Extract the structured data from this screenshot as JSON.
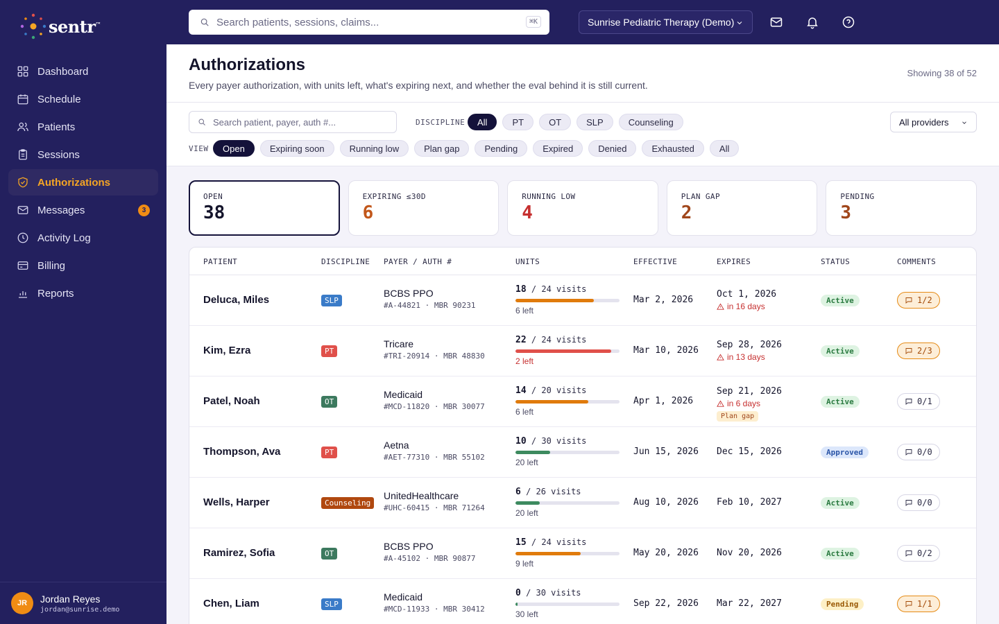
{
  "brand": {
    "name": "sentr",
    "tm": "™"
  },
  "nav": [
    {
      "label": "Dashboard",
      "icon": "grid-icon"
    },
    {
      "label": "Schedule",
      "icon": "calendar-icon"
    },
    {
      "label": "Patients",
      "icon": "users-icon"
    },
    {
      "label": "Sessions",
      "icon": "clipboard-icon"
    },
    {
      "label": "Authorizations",
      "icon": "shield-check-icon",
      "active": true
    },
    {
      "label": "Messages",
      "icon": "mail-icon",
      "badge": "3"
    },
    {
      "label": "Activity Log",
      "icon": "clock-icon"
    },
    {
      "label": "Billing",
      "icon": "credit-card-icon"
    },
    {
      "label": "Reports",
      "icon": "bar-chart-icon"
    }
  ],
  "user": {
    "initials": "JR",
    "name": "Jordan Reyes",
    "email": "jordan@sunrise.demo"
  },
  "topbar": {
    "search_placeholder": "Search patients, sessions, claims...",
    "shortcut": "⌘K",
    "org": "Sunrise Pediatric Therapy (Demo)"
  },
  "page": {
    "title": "Authorizations",
    "subtitle": "Every payer authorization, with units left, what's expiring next, and whether the eval behind it is still current.",
    "showing": "Showing 38 of 52"
  },
  "filters": {
    "search_placeholder": "Search patient, payer, auth #...",
    "discipline_label": "DISCIPLINE",
    "disciplines": [
      "All",
      "PT",
      "OT",
      "SLP",
      "Counseling"
    ],
    "discipline_selected": 0,
    "view_label": "VIEW",
    "views": [
      "Open",
      "Expiring soon",
      "Running low",
      "Plan gap",
      "Pending",
      "Expired",
      "Denied",
      "Exhausted",
      "All"
    ],
    "view_selected": 0,
    "provider": "All providers"
  },
  "stats": [
    {
      "label": "OPEN",
      "value": "38",
      "color": "#14142b",
      "selected": true
    },
    {
      "label": "EXPIRING ≤30D",
      "value": "6",
      "color": "#c2571a"
    },
    {
      "label": "RUNNING LOW",
      "value": "4",
      "color": "#c62f2f"
    },
    {
      "label": "PLAN GAP",
      "value": "2",
      "color": "#a0461b"
    },
    {
      "label": "PENDING",
      "value": "3",
      "color": "#a0461b"
    }
  ],
  "table": {
    "headers": [
      "PATIENT",
      "DISCIPLINE",
      "PAYER / AUTH #",
      "UNITS",
      "EFFECTIVE",
      "EXPIRES",
      "STATUS",
      "COMMENTS"
    ],
    "rows": [
      {
        "patient": "Deluca, Miles",
        "discipline": "SLP",
        "disc_color": "#3a7bc8",
        "payer": "BCBS PPO",
        "auth": "#A-44821 · MBR 90231",
        "used": "18",
        "total": "/ 24 visits",
        "fill": 0.75,
        "fill_color": "#e07b0c",
        "left": "6 left",
        "left_warn": false,
        "effective": "Mar 2, 2026",
        "expires": "Oct 1, 2026",
        "exp_warn": "in 16 days",
        "plan_gap": "",
        "status": "Active",
        "status_kind": "active",
        "comments": "1/2",
        "comments_hot": true
      },
      {
        "patient": "Kim, Ezra",
        "discipline": "PT",
        "disc_color": "#e0504a",
        "payer": "Tricare",
        "auth": "#TRI-20914 · MBR 48830",
        "used": "22",
        "total": "/ 24 visits",
        "fill": 0.917,
        "fill_color": "#e0504a",
        "left": "2 left",
        "left_warn": true,
        "effective": "Mar 10, 2026",
        "expires": "Sep 28, 2026",
        "exp_warn": "in 13 days",
        "plan_gap": "",
        "status": "Active",
        "status_kind": "active",
        "comments": "2/3",
        "comments_hot": true
      },
      {
        "patient": "Patel, Noah",
        "discipline": "OT",
        "disc_color": "#3d7a5f",
        "payer": "Medicaid",
        "auth": "#MCD-11820 · MBR 30077",
        "used": "14",
        "total": "/ 20 visits",
        "fill": 0.7,
        "fill_color": "#e07b0c",
        "left": "6 left",
        "left_warn": false,
        "effective": "Apr 1, 2026",
        "expires": "Sep 21, 2026",
        "exp_warn": "in 6 days",
        "plan_gap": "Plan gap",
        "status": "Active",
        "status_kind": "active",
        "comments": "0/1",
        "comments_hot": false
      },
      {
        "patient": "Thompson, Ava",
        "discipline": "PT",
        "disc_color": "#e0504a",
        "payer": "Aetna",
        "auth": "#AET-77310 · MBR 55102",
        "used": "10",
        "total": "/ 30 visits",
        "fill": 0.333,
        "fill_color": "#3d8a5f",
        "left": "20 left",
        "left_warn": false,
        "effective": "Jun 15, 2026",
        "expires": "Dec 15, 2026",
        "exp_warn": "",
        "plan_gap": "",
        "status": "Approved",
        "status_kind": "approved",
        "comments": "0/0",
        "comments_hot": false
      },
      {
        "patient": "Wells, Harper",
        "discipline": "Counseling",
        "disc_color": "#b0480f",
        "payer": "UnitedHealthcare",
        "auth": "#UHC-60415 · MBR 71264",
        "used": "6",
        "total": "/ 26 visits",
        "fill": 0.231,
        "fill_color": "#3d8a5f",
        "left": "20 left",
        "left_warn": false,
        "effective": "Aug 10, 2026",
        "expires": "Feb 10, 2027",
        "exp_warn": "",
        "plan_gap": "",
        "status": "Active",
        "status_kind": "active",
        "comments": "0/0",
        "comments_hot": false
      },
      {
        "patient": "Ramirez, Sofia",
        "discipline": "OT",
        "disc_color": "#3d7a5f",
        "payer": "BCBS PPO",
        "auth": "#A-45102 · MBR 90877",
        "used": "15",
        "total": "/ 24 visits",
        "fill": 0.625,
        "fill_color": "#e07b0c",
        "left": "9 left",
        "left_warn": false,
        "effective": "May 20, 2026",
        "expires": "Nov 20, 2026",
        "exp_warn": "",
        "plan_gap": "",
        "status": "Active",
        "status_kind": "active",
        "comments": "0/2",
        "comments_hot": false
      },
      {
        "patient": "Chen, Liam",
        "discipline": "SLP",
        "disc_color": "#3a7bc8",
        "payer": "Medicaid",
        "auth": "#MCD-11933 · MBR 30412",
        "used": "0",
        "total": "/ 30 visits",
        "fill": 0.02,
        "fill_color": "#3d8a5f",
        "left": "30 left",
        "left_warn": false,
        "effective": "Sep 22, 2026",
        "expires": "Mar 22, 2027",
        "exp_warn": "",
        "plan_gap": "",
        "status": "Pending",
        "status_kind": "pending",
        "comments": "1/1",
        "comments_hot": true
      }
    ]
  }
}
